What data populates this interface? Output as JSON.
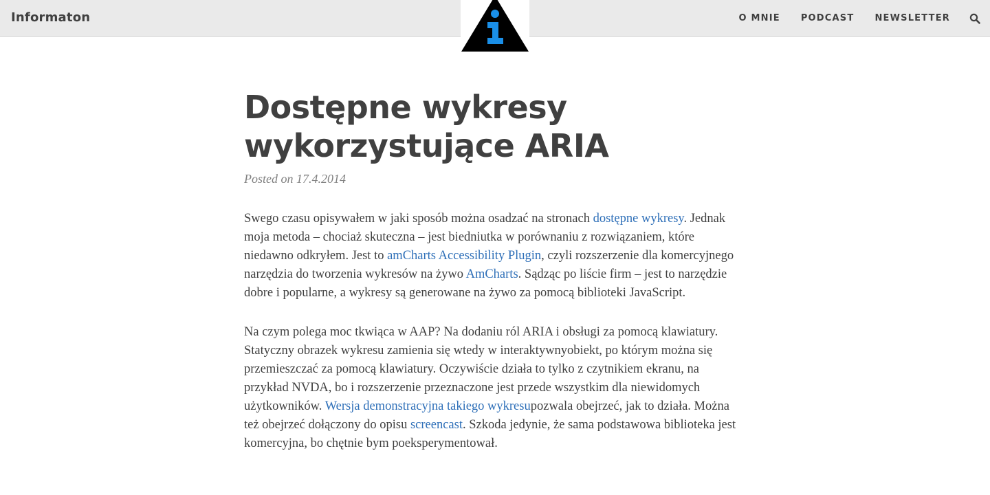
{
  "header": {
    "brand": "Informaton",
    "nav": [
      "O MNIE",
      "PODCAST",
      "NEWSLETTER"
    ],
    "search_icon": "search-icon",
    "logo_icon": "info-triangle-logo",
    "colors": {
      "bar_bg": "#eaeaea",
      "logo_accent": "#1a8fe8"
    }
  },
  "post": {
    "title_line1": "Dostępne wykresy",
    "title_line2": "wykorzystujące ARIA",
    "meta": "Posted on 17.4.2014",
    "p1": [
      "Swego czasu opisywałem w jaki sposób można osadzać na stronach ",
      "dostępne wykresy",
      ". Jednak moja metoda – chociaż skuteczna – jest biedniutka w porównaniu z rozwiązaniem, które niedawno odkryłem. Jest to ",
      "amCharts Accessibility Plugin",
      ", czyli rozszerzenie dla komercyjnego narzędzia do tworzenia wykresów na żywo ",
      "AmCharts",
      ". Sądząc po liście firm – jest to narzędzie dobre i popularne, a wykresy są generowane na żywo za pomocą biblioteki JavaScript."
    ],
    "p2": [
      "Na czym polega moc tkwiąca w AAP? Na dodaniu ról ARIA i obsługi za pomocą klawiatury. Statyczny obrazek wykresu zamienia się wtedy w interaktywnyobiekt, po którym można się przemieszczać za pomocą klawiatury. Oczywiście działa to tylko z czytnikiem ekranu, na przykład NVDA, bo i rozszerzenie przeznaczone jest przede wszystkim dla niewidomych użytkowników. ",
      "Wersja demonstracyjna takiego wykresu",
      "pozwala obejrzeć, jak to działa. Można też obejrzeć dołączony do opisu ",
      "screencast",
      ". Szkoda jedynie, że sama podstawowa biblioteka jest komercyjna, bo chętnie bym poeksperymentował."
    ],
    "link_color": "#2e6fb8"
  }
}
